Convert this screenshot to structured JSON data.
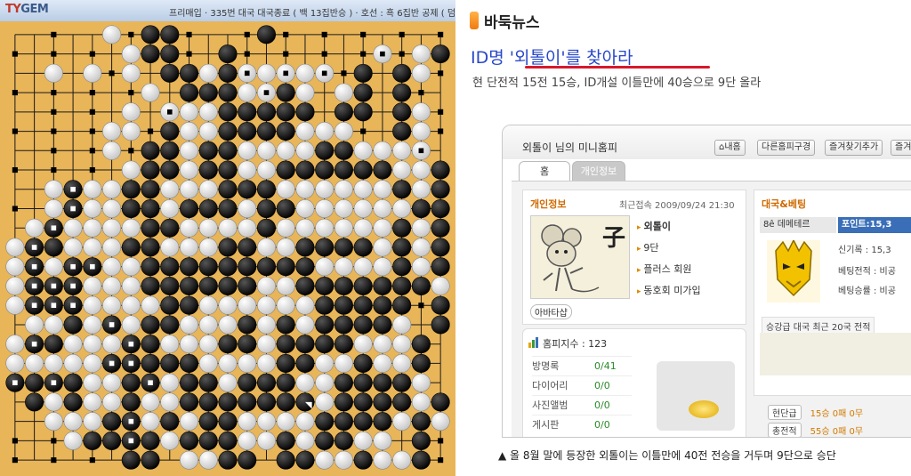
{
  "board_window": {
    "logo_main": "TY",
    "logo_accent": "GEM",
    "title_info": "프리매입 · 335번 대국   대국종료 ( 백 13집반승 ) · 호선 : 흑 6집반 공제 ( 덤"
  },
  "news": {
    "section": "바둑뉴스",
    "headline": "ID명 '외톨이'를 찾아라",
    "subhead": "현 단전적 15전 15승, ID개설 이틀만에 40승으로 9단 올라",
    "caption": "▲ 올 8월 말에 등장한 외톨이는 이틀만에 40전 전승을 거두며 9단으로 승단"
  },
  "hompy": {
    "title": "외톨이 님의 미니홈피",
    "buttons": [
      "⌂내홈",
      "다른홈피구경",
      "즐겨찾기추가",
      "즐겨찾"
    ],
    "tabs": [
      "홈",
      "개인정보"
    ],
    "profile": {
      "title": "개인정보",
      "last_login": "최근접속 2009/09/24 21:30",
      "avatar_char": "子",
      "items": [
        "외톨이",
        "9단",
        "플러스 회원",
        "동호회 미가입"
      ],
      "avatar_shop": "아바타샵"
    },
    "stats": {
      "title": "홈피지수 : 123",
      "rows": [
        {
          "label": "방명록",
          "value": "0/41"
        },
        {
          "label": "다이어리",
          "value": "0/0"
        },
        {
          "label": "사진앨범",
          "value": "0/0"
        },
        {
          "label": "게시판",
          "value": "0/0"
        }
      ]
    },
    "right_card": {
      "title": "대국&베팅",
      "corner": "L",
      "name_tag": "8ê 데메테르",
      "points": "포인트:15,3",
      "items": [
        "신기록 : 15,3",
        "베팅전적 : 비공",
        "베팅승률 : 비공"
      ],
      "recent_label": "승강급 대국 최근 20국 전적",
      "rows": [
        {
          "label": "현단급",
          "value": "15승 0패 0무"
        },
        {
          "label": "총전적",
          "value": "55승 0패 0무"
        }
      ]
    }
  },
  "colors": {
    "board_wood": "#e8b559",
    "board_line": "#1a1a1a",
    "headline_blue": "#2848c8",
    "underline_red": "#d8182c",
    "section_orange": "#f07a10"
  },
  "board_rows": [
    "..*..W*BB*..*B*.*.*.*.*",
    "*.*.*.WBB*.B*.*.*.*m*WB",
    "..W.W*W.BBWBmWmWm*B.BW*",
    "*.*.*.*W.BBBWmBW.WB.B*.",
    "..*.*.W.mWWBBBBB.BB.BW*",
    "*.*.*WW*BWWBBBBWWW*.BW*",
    "..*.*W*BBWBBWWWWBBWWWm.",
    "*.*.*.WBBWBBWWBBBBBBWWB",
    "..WwWWBBWWWBBBWWWWWWBWB",
    "*.WwWWBBWBBBWBBWWWWWWBB",
    ".WwWWWWBBWWWWBWWWWWWBWB",
    "WwBWWWBBWWWBBWWBBBBWBWB",
    "WwWwwWWBBBBBBBBBWWWWBWB",
    "WwwwWWWBBBBBBWWBBBBBBBW",
    "WwwwWWWWBBWWWWWWBBBBB*B",
    ".WWBWwWBBWWWBWBWBBBBW.B",
    "WwBWWWwBWWWBBWBBBBWWWB.",
    "WWWWWwwBBBWWWWBBWWBWWB.",
    "wBwBWWBwWBBWBBBWWBBBBW.",
    ".BWBWWBWWBBBBBBpWBBBBWB",
    "..WWWBwWBWBBWWWWBBBBWBW",
    "*.*WBBwBWBBBWWBWBBWW.B*",
    "*.*.*.BB.WWBB.BBWWBWWB*"
  ]
}
